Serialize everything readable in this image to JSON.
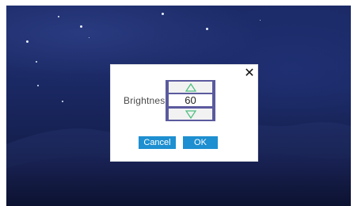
{
  "dialog": {
    "close_glyph": "✕",
    "brightness_label": "Brightness",
    "brightness_value": "60",
    "up_icon": "triangle-up-outline",
    "down_icon": "triangle-down-outline",
    "cancel_label": "Cancel",
    "ok_label": "OK"
  },
  "colors": {
    "background_sky": "#1b2a67",
    "stepper_frame": "#5b5a9e",
    "button_blue": "#1e8fd0",
    "arrow_green": "#4fbf7f"
  }
}
